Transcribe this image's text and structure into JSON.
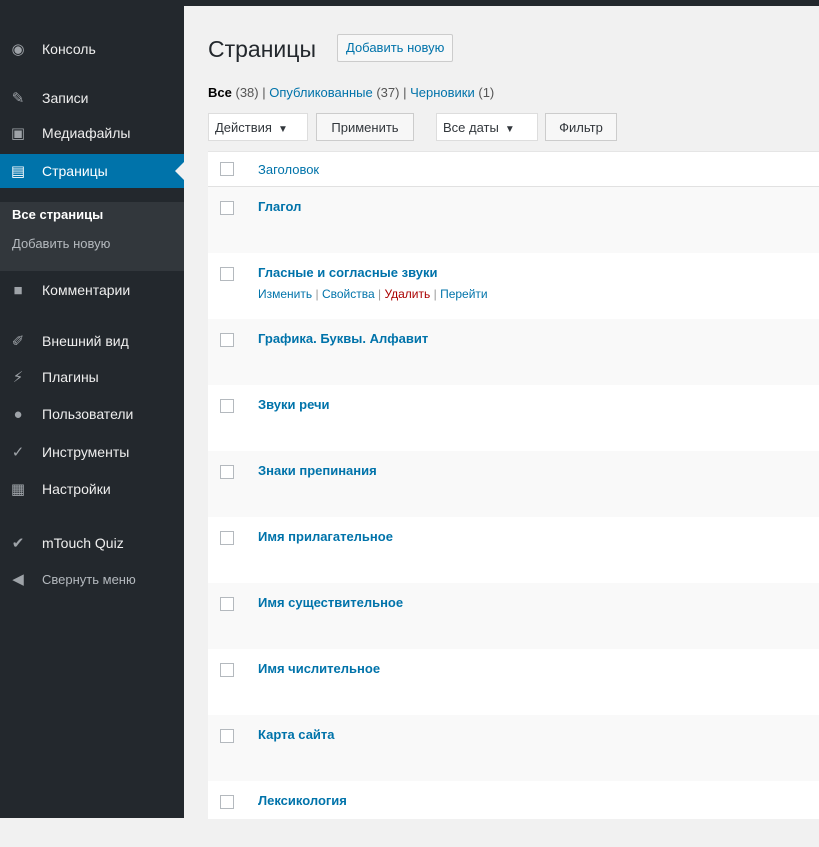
{
  "sidebar": {
    "items": [
      {
        "label": "Консоль",
        "icon": "dashboard-icon"
      },
      {
        "label": "Записи",
        "icon": "pin-icon"
      },
      {
        "label": "Медиафайлы",
        "icon": "media-icon"
      },
      {
        "label": "Страницы",
        "icon": "pages-icon"
      },
      {
        "label": "Комментарии",
        "icon": "comment-icon"
      },
      {
        "label": "Внешний вид",
        "icon": "appearance-icon"
      },
      {
        "label": "Плагины",
        "icon": "plugin-icon"
      },
      {
        "label": "Пользователи",
        "icon": "users-icon"
      },
      {
        "label": "Инструменты",
        "icon": "tools-icon"
      },
      {
        "label": "Настройки",
        "icon": "settings-icon"
      },
      {
        "label": "mTouch Quiz",
        "icon": "check-icon"
      },
      {
        "label": "Свернуть меню",
        "icon": "collapse-icon"
      }
    ],
    "submenu": [
      "Все страницы",
      "Добавить новую"
    ]
  },
  "page": {
    "title": "Страницы",
    "add_new": "Добавить новую"
  },
  "filters": {
    "all": "Все",
    "all_count": "(38)",
    "published": "Опубликованные",
    "published_count": "(37)",
    "drafts": "Черновики",
    "drafts_count": "(1)"
  },
  "bulk": {
    "actions": "Действия",
    "apply": "Применить",
    "dates": "Все даты",
    "filter": "Фильтр"
  },
  "table": {
    "header": "Заголовок",
    "rows": [
      "Глагол",
      "Гласные и согласные звуки",
      "Графика. Буквы. Алфавит",
      "Звуки речи",
      "Знаки препинания",
      "Имя прилагательное",
      "Имя существительное",
      "Имя числительное",
      "Карта сайта",
      "Лексикология"
    ],
    "row_actions": [
      "Изменить",
      "Свойства",
      "Удалить",
      "Перейти"
    ]
  },
  "colors": {
    "accent": "#0073aa",
    "sidebar": "#23282d",
    "delete": "#a00"
  }
}
